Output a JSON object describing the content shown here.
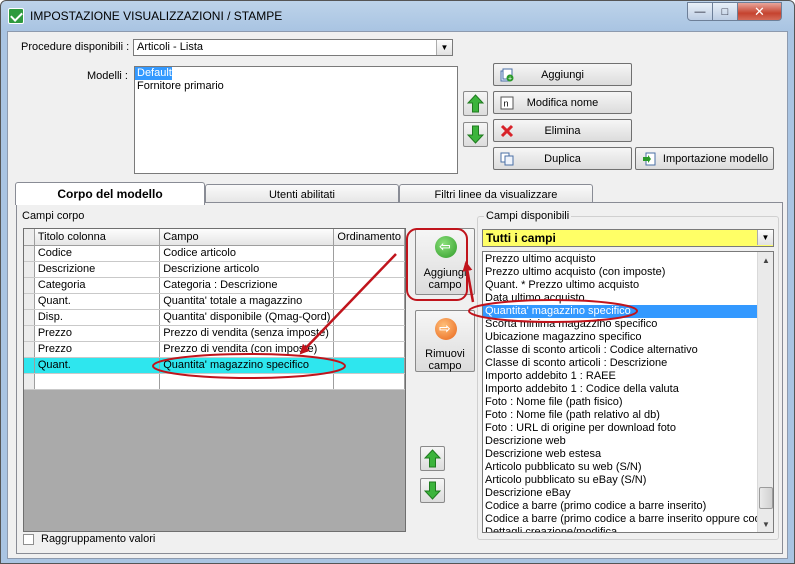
{
  "window": {
    "title": "IMPOSTAZIONE VISUALIZZAZIONI / STAMPE",
    "min_glyph": "—",
    "max_glyph": "□",
    "close_glyph": "✕"
  },
  "procedure": {
    "label": "Procedure disponibili :",
    "value": "Articoli - Lista"
  },
  "modelli": {
    "label": "Modelli :",
    "items": [
      "Default",
      "Fornitore primario"
    ],
    "selected_index": 0
  },
  "buttons": {
    "aggiungi": "Aggiungi",
    "modifica_nome": "Modifica nome",
    "elimina": "Elimina",
    "duplica": "Duplica",
    "importazione": "Importazione modello"
  },
  "tabs": [
    {
      "label": "Corpo del modello",
      "active": true
    },
    {
      "label": "Utenti abilitati",
      "active": false
    },
    {
      "label": "Filtri linee da visualizzare",
      "active": false
    }
  ],
  "campi_corpo": {
    "label": "Campi corpo",
    "headers": [
      "Titolo colonna",
      "Campo",
      "Ordinamento"
    ],
    "rows": [
      {
        "titolo": "Codice",
        "campo": "Codice articolo",
        "ordinamento": ""
      },
      {
        "titolo": "Descrizione",
        "campo": "Descrizione articolo",
        "ordinamento": ""
      },
      {
        "titolo": "Categoria",
        "campo": "Categoria : Descrizione",
        "ordinamento": ""
      },
      {
        "titolo": "Quant.",
        "campo": "Quantita' totale a magazzino",
        "ordinamento": ""
      },
      {
        "titolo": "Disp.",
        "campo": "Quantita' disponibile (Qmag-Qord)",
        "ordinamento": ""
      },
      {
        "titolo": "Prezzo",
        "campo": "Prezzo di vendita (senza imposte)",
        "ordinamento": ""
      },
      {
        "titolo": "Prezzo",
        "campo": "Prezzo di vendita (con imposte)",
        "ordinamento": ""
      },
      {
        "titolo": "Quant.",
        "campo": "Quantita' magazzino specifico",
        "ordinamento": ""
      }
    ],
    "selected_index": 7
  },
  "actions": {
    "aggiungi_campo": "Aggiungi campo",
    "rimuovi_campo": "Rimuovi campo"
  },
  "campi_disponibili": {
    "label": "Campi disponibili",
    "filter_value": "Tutti i campi",
    "items": [
      "Prezzo ultimo acquisto",
      "Prezzo ultimo acquisto (con imposte)",
      "Quant. * Prezzo ultimo acquisto",
      "Data ultimo acquisto",
      "Quantita' magazzino specifico",
      "Scorta minima magazzino specifico",
      "Ubicazione magazzino specifico",
      "Classe di sconto articoli : Codice alternativo",
      "Classe di sconto articoli : Descrizione",
      "Importo addebito 1 : RAEE",
      "Importo addebito 1 : Codice della valuta",
      "Foto : Nome file (path fisico)",
      "Foto : Nome file (path relativo al db)",
      "Foto : URL di origine per download foto",
      "Descrizione web",
      "Descrizione web estesa",
      "Articolo pubblicato su web (S/N)",
      "Articolo pubblicato su eBay (S/N)",
      "Descrizione eBay",
      "Codice a barre (primo codice a barre inserito)",
      "Codice a barre (primo codice a barre inserito oppure codice articolo)",
      "Dettagli creazione/modifica"
    ],
    "selected_index": 4
  },
  "raggruppamento": {
    "label": "Raggruppamento valori",
    "checked": false
  },
  "colors": {
    "highlight_cyan": "#2ee6ee",
    "selection_blue": "#3399ff",
    "filter_yellow": "#ffff66",
    "annotation_red": "#c0141c",
    "arrow_green": "#3cb43c",
    "add_circle": "#4cae3c",
    "remove_circle": "#f07a22"
  }
}
